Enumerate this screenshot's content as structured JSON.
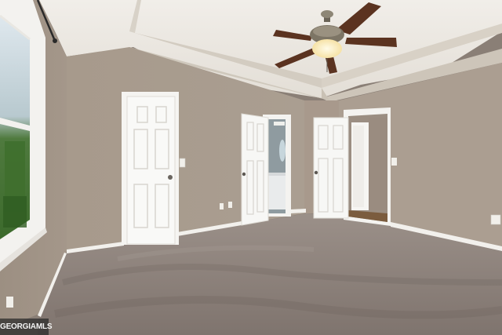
{
  "photo": {
    "subject": "empty-bedroom-interior",
    "elements": [
      "ceiling-fan",
      "tray-ceiling",
      "window",
      "closet-door",
      "bathroom-doorway",
      "hallway-doorway",
      "carpet-floor"
    ]
  },
  "watermark": {
    "text": "GEORGIAMLS"
  },
  "colors": {
    "wall": "#a99c8f",
    "ceiling": "#ece8e1",
    "carpet": "#8b8079",
    "trim": "#f4f3f0"
  }
}
